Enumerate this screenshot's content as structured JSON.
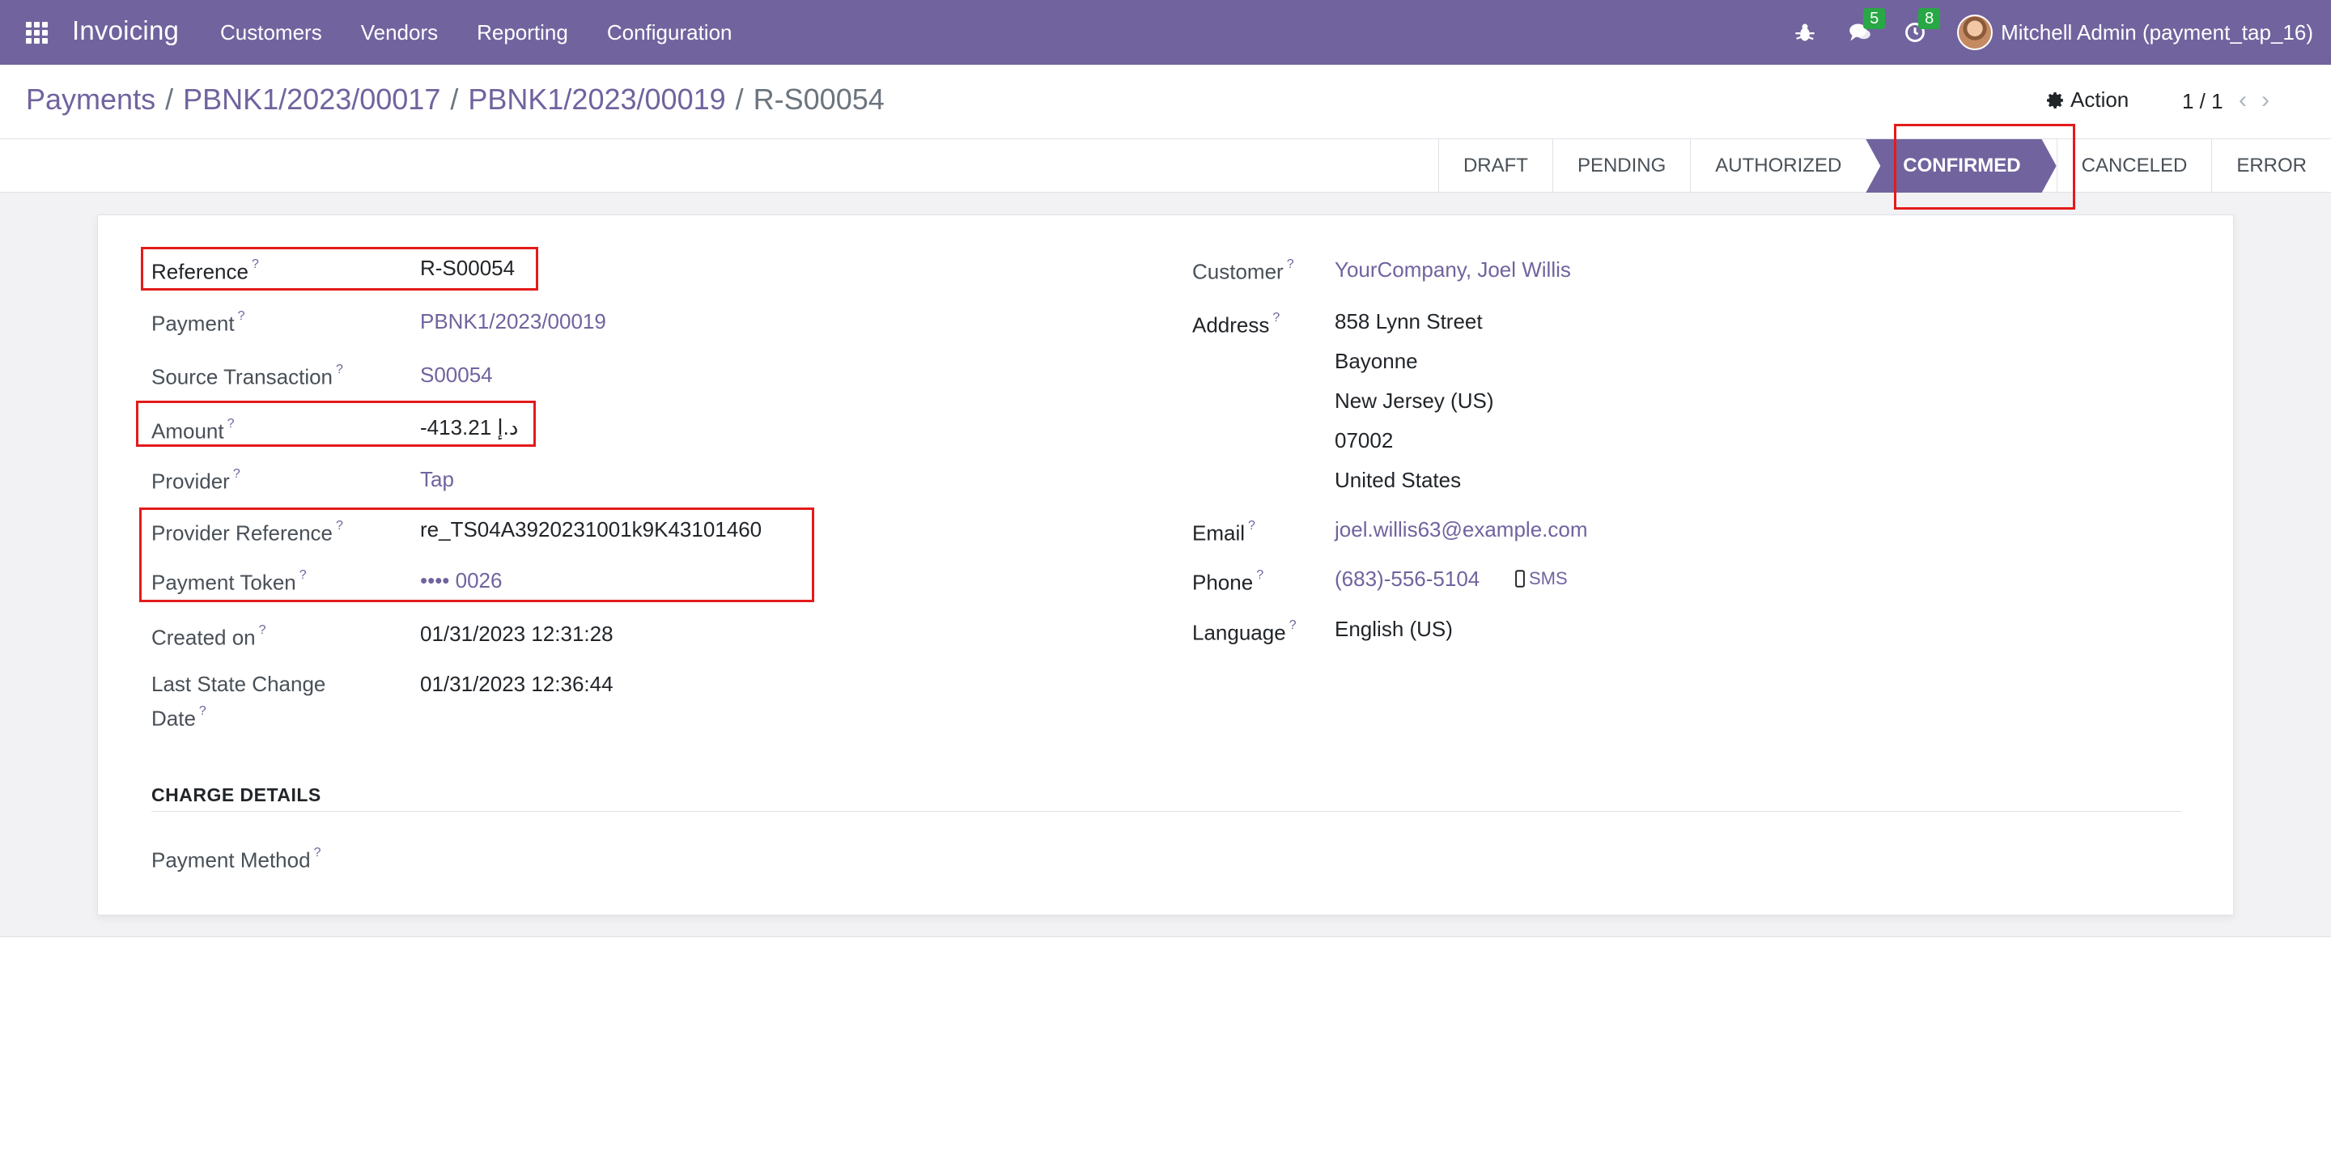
{
  "navbar": {
    "app_name": "Invoicing",
    "menu": [
      "Customers",
      "Vendors",
      "Reporting",
      "Configuration"
    ],
    "messages_count": "5",
    "activities_count": "8",
    "user_name": "Mitchell Admin (payment_tap_16)",
    "color": "#71639e"
  },
  "breadcrumb": {
    "items": [
      "Payments",
      "PBNK1/2023/00017",
      "PBNK1/2023/00019"
    ],
    "separator": "/",
    "current": "R-S00054"
  },
  "control": {
    "action_label": "Action",
    "pager": "1 / 1",
    "prev_icon": "‹",
    "next_icon": "›"
  },
  "statusbar": {
    "stages": [
      "DRAFT",
      "PENDING",
      "AUTHORIZED",
      "CONFIRMED",
      "CANCELED",
      "ERROR"
    ],
    "active": "CONFIRMED"
  },
  "form": {
    "left": {
      "reference": {
        "label": "Reference",
        "value": "R-S00054"
      },
      "payment": {
        "label": "Payment",
        "value": "PBNK1/2023/00019"
      },
      "source_transaction": {
        "label": "Source Transaction",
        "value": "S00054"
      },
      "amount": {
        "label": "Amount",
        "value": "-413.21 د.إ"
      },
      "provider": {
        "label": "Provider",
        "value": "Tap"
      },
      "provider_reference": {
        "label": "Provider Reference",
        "value": "re_TS04A3920231001k9K43101460"
      },
      "payment_token": {
        "label": "Payment Token",
        "value": "•••• 0026"
      },
      "created_on": {
        "label": "Created on",
        "value": "01/31/2023 12:31:28"
      },
      "last_state_change": {
        "label_line1": "Last State Change",
        "label_line2": "Date",
        "value": "01/31/2023 12:36:44"
      }
    },
    "right": {
      "customer": {
        "label": "Customer",
        "value": "YourCompany, Joel Willis"
      },
      "address": {
        "label": "Address",
        "lines": [
          "858 Lynn Street",
          "Bayonne",
          "New Jersey (US)",
          "07002",
          "United States"
        ]
      },
      "email": {
        "label": "Email",
        "value": "joel.willis63@example.com"
      },
      "phone": {
        "label": "Phone",
        "value": "(683)-556-5104",
        "sms_label": "SMS"
      },
      "language": {
        "label": "Language",
        "value": "English (US)"
      }
    },
    "help_mark": "?",
    "charge_details": {
      "title": "CHARGE DETAILS",
      "payment_method_label": "Payment Method"
    }
  }
}
